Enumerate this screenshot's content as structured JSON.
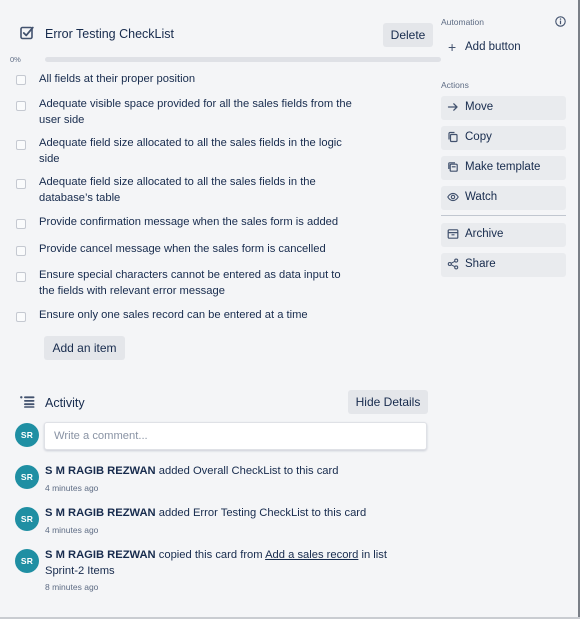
{
  "checklist": {
    "title": "Error Testing CheckList",
    "delete_label": "Delete",
    "progress_label": "0%",
    "progress_fraction": 0,
    "items": [
      {
        "text": "All fields at their proper position",
        "checked": false
      },
      {
        "text": "Adequate visible space provided for all the sales fields from the user side",
        "checked": false
      },
      {
        "text": "Adequate field size allocated to all the sales fields in the logic side",
        "checked": false
      },
      {
        "text": "Adequate field size allocated to all the sales fields in the database’s table",
        "checked": false
      },
      {
        "text": "Provide confirmation message when the sales form is added",
        "checked": false
      },
      {
        "text": "Provide cancel message when the sales form is cancelled",
        "checked": false
      },
      {
        "text": "Ensure special characters cannot be entered as data input to the fields with relevant error message",
        "checked": false
      },
      {
        "text": "Ensure only one sales record can be entered at a time",
        "checked": false
      }
    ],
    "add_item_label": "Add an item"
  },
  "activity": {
    "title": "Activity",
    "hide_details_label": "Hide Details",
    "avatar_initials": "SR",
    "comment_placeholder": "Write a comment...",
    "entries": [
      {
        "user": "S M RAGIB REZWAN",
        "action": " added Overall CheckList to this card",
        "time": "4 minutes ago"
      },
      {
        "user": "S M RAGIB REZWAN",
        "action": " added Error Testing CheckList to this card",
        "time": "4 minutes ago"
      },
      {
        "user": "S M RAGIB REZWAN",
        "action_before": " copied this card from ",
        "link": "Add a sales record",
        "action_after": " in list Sprint-2 Items",
        "time": "8 minutes ago"
      }
    ]
  },
  "sidebar": {
    "automation_label": "Automation",
    "add_button_label": "Add button",
    "actions_label": "Actions",
    "actions": [
      {
        "label": "Move",
        "icon": "arrow-right-icon"
      },
      {
        "label": "Copy",
        "icon": "copy-icon"
      },
      {
        "label": "Make template",
        "icon": "template-icon"
      },
      {
        "label": "Watch",
        "icon": "eye-icon"
      },
      {
        "label": "Archive",
        "icon": "archive-icon"
      },
      {
        "label": "Share",
        "icon": "share-icon"
      }
    ]
  },
  "colors": {
    "accent": "#5ba4cf",
    "avatar": "#1f8fa3",
    "button_bg": "#e4e6ea",
    "page_bg": "#f4f5f7"
  }
}
